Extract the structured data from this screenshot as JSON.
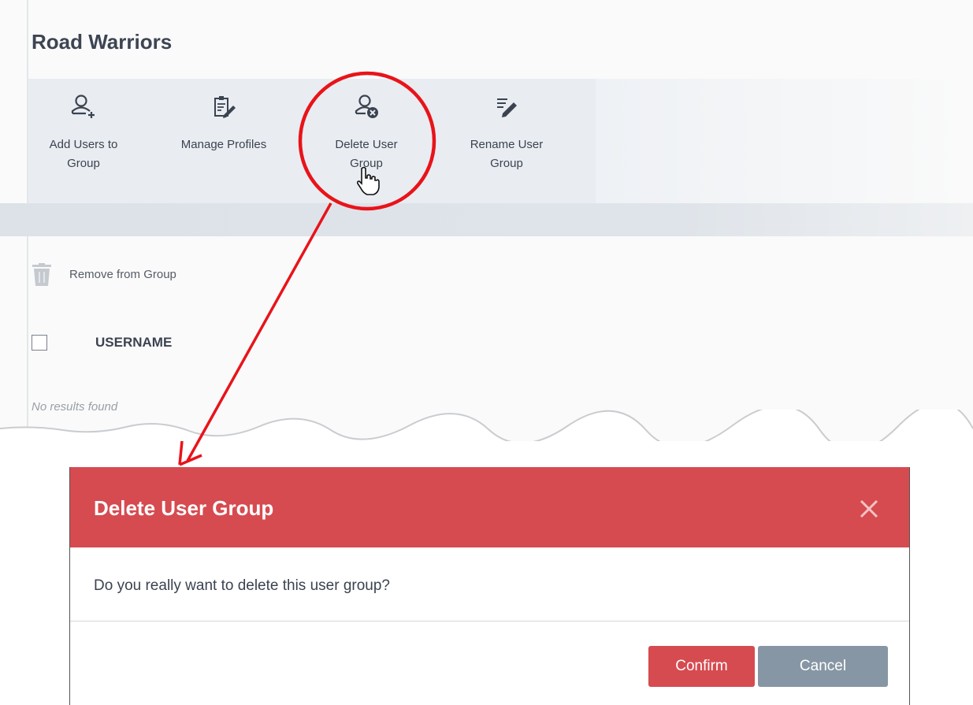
{
  "page": {
    "title": "Road Warriors"
  },
  "toolbar": {
    "add_users": {
      "label_line1": "Add Users to",
      "label_line2": "Group",
      "icon": "add-user-icon"
    },
    "manage_profiles": {
      "label_line1": "Manage Profiles",
      "icon": "clipboard-edit-icon"
    },
    "delete_group": {
      "label_line1": "Delete User",
      "label_line2": "Group",
      "icon": "delete-user-icon"
    },
    "rename_group": {
      "label_line1": "Rename User",
      "label_line2": "Group",
      "icon": "rename-pencil-icon"
    }
  },
  "list": {
    "remove_label": "Remove from Group",
    "column_header": "USERNAME",
    "empty_text": "No results found"
  },
  "dialog": {
    "title": "Delete User Group",
    "message": "Do you really want to delete this user group?",
    "confirm_label": "Confirm",
    "cancel_label": "Cancel"
  },
  "colors": {
    "dialog_header": "#d64b50",
    "confirm_button": "#d64b50",
    "cancel_button": "#8796a4",
    "annotation": "#e8141a"
  }
}
